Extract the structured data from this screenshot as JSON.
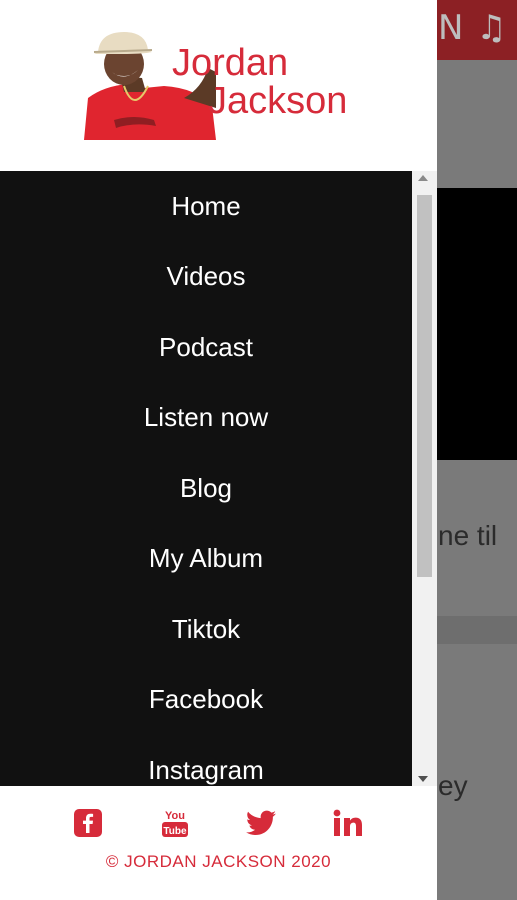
{
  "background": {
    "header_text": "N ♫",
    "text_line1": "ne til",
    "text_line2": "ey"
  },
  "drawer": {
    "logo": {
      "name_line1": "Jordan",
      "name_line2": "Jackson"
    },
    "menu": [
      {
        "label": "Home"
      },
      {
        "label": "Videos"
      },
      {
        "label": "Podcast"
      },
      {
        "label": "Listen now"
      },
      {
        "label": "Blog"
      },
      {
        "label": "My Album"
      },
      {
        "label": "Tiktok"
      },
      {
        "label": "Facebook"
      },
      {
        "label": "Instagram"
      }
    ],
    "social": [
      {
        "icon": "facebook-icon"
      },
      {
        "icon": "youtube-icon"
      },
      {
        "icon": "twitter-icon"
      },
      {
        "icon": "linkedin-icon"
      }
    ],
    "copyright": "© JORDAN JACKSON 2020"
  },
  "colors": {
    "brand_red": "#d62b3a",
    "menu_bg": "#111111"
  }
}
